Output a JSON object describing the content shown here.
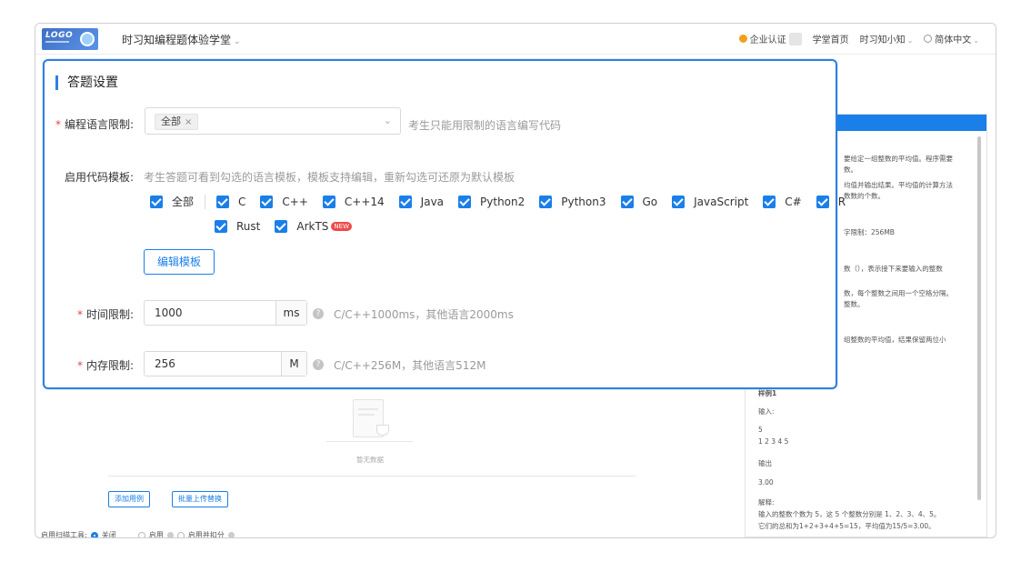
{
  "header": {
    "logo_text": "LOGO",
    "app_title": "时习知编程题体验学堂",
    "cert_label": "企业认证",
    "links": [
      "学堂首页",
      "时习知小知",
      "简体中文"
    ]
  },
  "modal": {
    "title": "答题设置",
    "lang_limit": {
      "label": "编程语言限制:",
      "selected_tag": "全部",
      "tag_close": "×",
      "hint": "考生只能用限制的语言编写代码"
    },
    "template": {
      "label": "启用代码模板:",
      "hint": "考生答题可看到勾选的语言模板，模板支持编辑，重新勾选可还原为默认模板",
      "all_label": "全部",
      "languages_row1": [
        "C",
        "C++",
        "C++14",
        "Java",
        "Python2",
        "Python3",
        "Go",
        "JavaScript",
        "C#",
        "R"
      ],
      "languages_row2": [
        "Rust",
        "ArkTS"
      ],
      "new_badge": "NEW",
      "edit_button": "编辑模板"
    },
    "time_limit": {
      "label": "时间限制:",
      "value": "1000",
      "unit": "ms",
      "hint": "C/C++1000ms，其他语言2000ms"
    },
    "memory_limit": {
      "label": "内存限制:",
      "value": "256",
      "unit": "M",
      "hint": "C/C++256M，其他语言512M"
    }
  },
  "background": {
    "empty_text": "暂无数据",
    "add_case_button": "添加用例",
    "batch_upload_button": "批量上传替换",
    "scan_tool_label": "启用扫描工具:",
    "scan_options": [
      "关闭",
      "启用",
      "启用并扣分"
    ],
    "right_panel_lines": [
      "要给定一组整数的平均值。程序需要",
      "数。",
      "均值并输出结果。平均值的计算方法",
      "数数的个数。",
      "字限制：256MB",
      "数（），表示接下来要输入的整数",
      "数，每个整数之间用一个空格分隔。",
      "整数。",
      "组整数的平均值，结果保留两位小",
      "样例1",
      "输入:",
      "5",
      "1 2 3 4 5",
      "输出",
      "3.00",
      "解释:",
      "输入的整数个数为 5，这 5 个整数分别是 1、2、3、4、5。",
      "它们的总和为1+2+3+4+5=15，平均值为15/5=3.00。"
    ]
  },
  "colors": {
    "accent": "#1a7fe8",
    "modal_border": "#2f7fe0",
    "required": "#e64545",
    "new_badge": "#f04848"
  }
}
